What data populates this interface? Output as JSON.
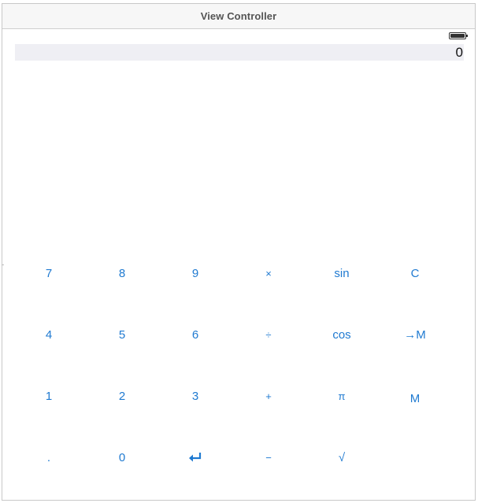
{
  "window": {
    "title": "View Controller"
  },
  "display": {
    "value": "0"
  },
  "status_bar": {
    "icon": "battery-icon"
  },
  "keypad": {
    "rows": [
      [
        "7",
        "8",
        "9",
        "×",
        "sin",
        "C"
      ],
      [
        "4",
        "5",
        "6",
        "÷",
        "cos",
        "→M"
      ],
      [
        "1",
        "2",
        "3",
        "+",
        "π",
        "M"
      ],
      [
        ".",
        "0",
        "",
        "−",
        "√",
        ""
      ]
    ],
    "enter_icon": "return-arrow-icon"
  },
  "colors": {
    "accent": "#1f7ad1",
    "display_background": "#efeff4"
  }
}
